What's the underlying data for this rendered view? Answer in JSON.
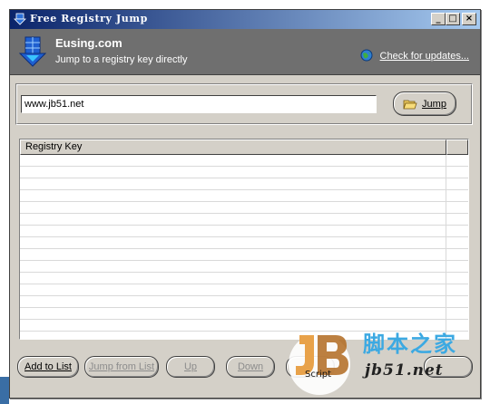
{
  "window": {
    "title": "Free Registry Jump",
    "controls": [
      "_",
      "□",
      "×"
    ]
  },
  "banner": {
    "company": "Eusing.com",
    "subtitle": "Jump to a registry key directly",
    "update_link": "Check for updates..."
  },
  "input": {
    "value": "www.jb51.net"
  },
  "jump_button": {
    "label": "Jump"
  },
  "listview": {
    "columns": [
      "Registry Key"
    ],
    "rows": []
  },
  "buttons": {
    "add_to_list": "Add to List",
    "jump_from_list": "Jump from List",
    "up": "Up",
    "down": "Down"
  },
  "watermark": {
    "cn_text": "脚本之家",
    "en_text": "jb51.net",
    "script_text": "Script"
  },
  "colors": {
    "title_gradient_start": "#0a246a",
    "title_gradient_end": "#a6caf0",
    "banner_bg": "#6f6f6f",
    "face": "#d4d0c8",
    "watermark_blue": "#3ca9e2",
    "watermark_orange": "#e8a24a"
  }
}
